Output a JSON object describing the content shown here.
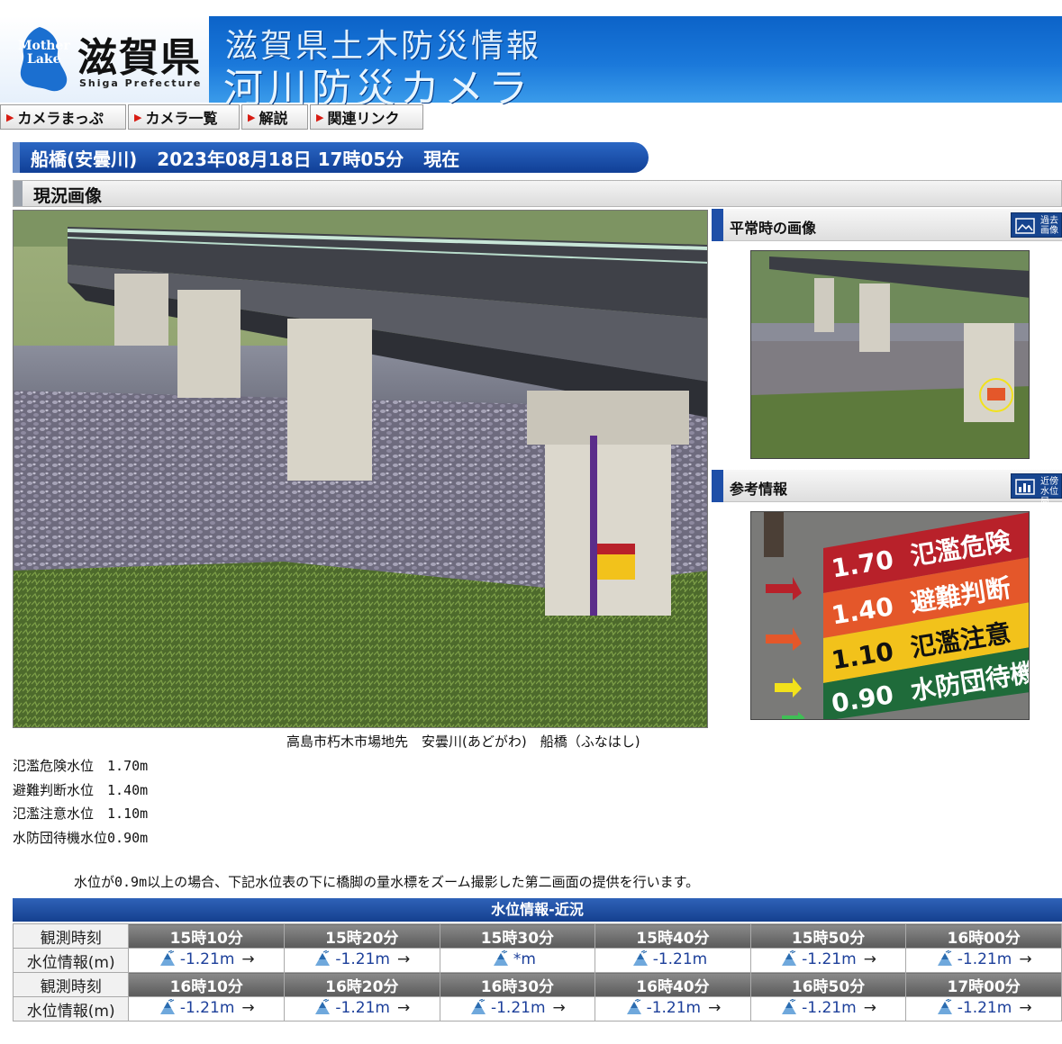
{
  "header": {
    "logo_text_top": "Mother",
    "logo_text_bottom": "Lake",
    "prefecture": "滋賀県",
    "prefecture_en": "Shiga Prefecture",
    "title_line1": "滋賀県土木防災情報",
    "title_line2": "河川防災カメラ"
  },
  "nav": {
    "items": [
      {
        "label": "カメラまっぷ"
      },
      {
        "label": "カメラ一覧"
      },
      {
        "label": "解説"
      },
      {
        "label": "関連リンク"
      }
    ]
  },
  "location": {
    "name": "船橋(安曇川)",
    "datetime": "2023年08月18日 17時05分",
    "status": "現在"
  },
  "section": {
    "title": "現況画像"
  },
  "side": {
    "normal_title": "平常時の画像",
    "normal_button": "過去画像",
    "ref_title": "参考情報",
    "ref_button": "近傍水位局"
  },
  "reference_sign": {
    "rows": [
      {
        "value": "1.70",
        "label": "氾濫危険",
        "color": "#b8212a"
      },
      {
        "value": "1.40",
        "label": "避難判断",
        "color": "#e4572a"
      },
      {
        "value": "1.10",
        "label": "氾濫注意",
        "color": "#f2c21b"
      },
      {
        "value": "0.90",
        "label": "水防団待機",
        "color": "#1f6b3a"
      }
    ]
  },
  "caption": "高島市朽木市場地先　安曇川(あどがわ)　船橋（ふなはし)",
  "levels": [
    {
      "label": "氾濫危険水位",
      "value": "1.70m"
    },
    {
      "label": "避難判断水位",
      "value": "1.40m"
    },
    {
      "label": "氾濫注意水位",
      "value": "1.10m"
    },
    {
      "label": "水防団待機水位",
      "value": "0.90m"
    }
  ],
  "notice": "水位が0.9m以上の場合、下記水位表の下に橋脚の量水標をズーム撮影した第二画面の提供を行います。",
  "water_table": {
    "title": "水位情報-近況",
    "time_label": "観測時刻",
    "value_label": "水位情報(m)",
    "rows": [
      {
        "times": [
          "15時10分",
          "15時20分",
          "15時30分",
          "15時40分",
          "15時50分",
          "16時00分"
        ],
        "values": [
          "-1.21m",
          "-1.21m",
          "*m",
          "-1.21m",
          "-1.21m",
          "-1.21m"
        ],
        "arrows": [
          "→",
          "→",
          "",
          "",
          "→",
          "→"
        ]
      },
      {
        "times": [
          "16時10分",
          "16時20分",
          "16時30分",
          "16時40分",
          "16時50分",
          "17時00分"
        ],
        "values": [
          "-1.21m",
          "-1.21m",
          "-1.21m",
          "-1.21m",
          "-1.21m",
          "-1.21m"
        ],
        "arrows": [
          "→",
          "→",
          "→",
          "→",
          "→",
          "→"
        ]
      }
    ]
  },
  "colors": {
    "header_blue": "#1a78da",
    "nav_triangle": "#d81b12",
    "location_bar": "#103f96",
    "table_title": "#15408f",
    "value_text": "#1c3f9a"
  }
}
